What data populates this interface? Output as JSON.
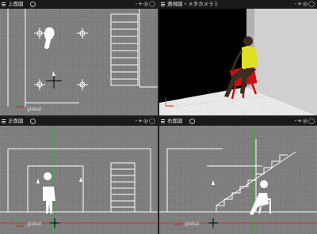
{
  "viewports": [
    {
      "title": "上面図",
      "tools": "-+◎◯",
      "ortho": true,
      "glabel": "global"
    },
    {
      "title": "透視図・メタカメラ１",
      "tools": "-+◎◯",
      "ortho": false,
      "glabel": ""
    },
    {
      "title": "正面図",
      "tools": "-+◎◯",
      "ortho": true,
      "glabel": "global"
    },
    {
      "title": "右面図",
      "tools": "-+◎◯",
      "ortho": true,
      "glabel": "global"
    }
  ],
  "colors": {
    "grid_bg": "#7f7f7f",
    "grid_line": "#8c8c8c",
    "geometry": "#ffffff",
    "header": "#1a1a1a",
    "chair": "#cc1111",
    "shirt": "#e0e020",
    "floor": "#e8e8e8"
  }
}
